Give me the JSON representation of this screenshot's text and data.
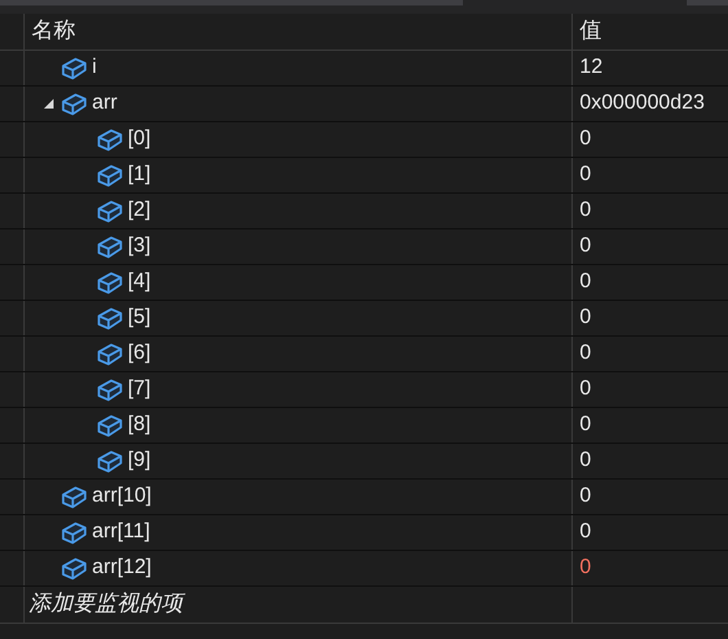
{
  "columns": [
    "名称",
    "值"
  ],
  "rows": [
    {
      "name": "i",
      "value": "12",
      "changed": false
    },
    {
      "name": "arr",
      "value": "0x000000d23",
      "changed": false,
      "expanded": true,
      "children": [
        {
          "name": "[0]",
          "value": "0",
          "changed": false
        },
        {
          "name": "[1]",
          "value": "0",
          "changed": false
        },
        {
          "name": "[2]",
          "value": "0",
          "changed": false
        },
        {
          "name": "[3]",
          "value": "0",
          "changed": false
        },
        {
          "name": "[4]",
          "value": "0",
          "changed": false
        },
        {
          "name": "[5]",
          "value": "0",
          "changed": false
        },
        {
          "name": "[6]",
          "value": "0",
          "changed": false
        },
        {
          "name": "[7]",
          "value": "0",
          "changed": false
        },
        {
          "name": "[8]",
          "value": "0",
          "changed": false
        },
        {
          "name": "[9]",
          "value": "0",
          "changed": false
        }
      ]
    },
    {
      "name": "arr[10]",
      "value": "0",
      "changed": false
    },
    {
      "name": "arr[11]",
      "value": "0",
      "changed": false
    },
    {
      "name": "arr[12]",
      "value": "0",
      "changed": true
    }
  ],
  "add_item": {
    "placeholder": "添加要监视的项"
  }
}
